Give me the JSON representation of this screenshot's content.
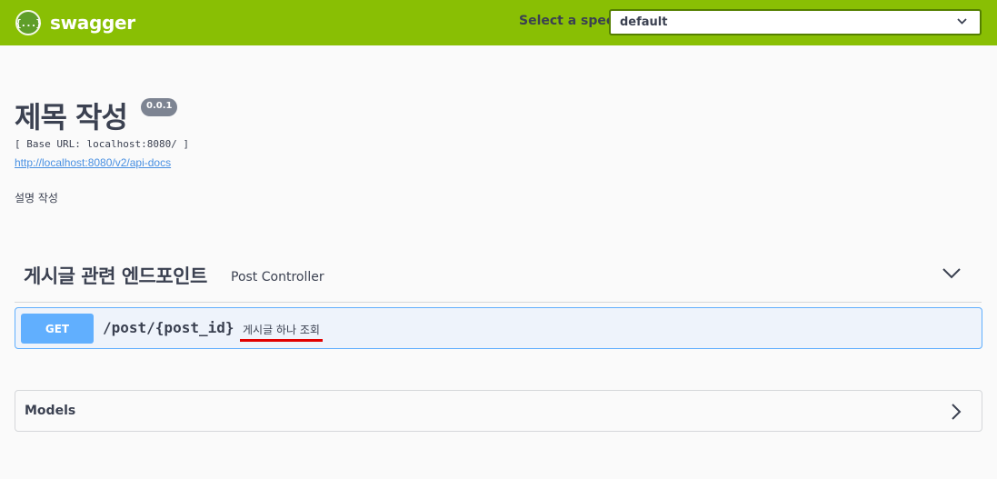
{
  "topbar": {
    "logo_glyph": "{...}",
    "brand": "swagger",
    "select_label": "Select a spec",
    "select_value": "default",
    "color": "#89bf04"
  },
  "info": {
    "title": "제목 작성",
    "version": "0.0.1",
    "base_url": "[ Base URL: localhost:8080/ ]",
    "docs_link": "http://localhost:8080/v2/api-docs",
    "description": "설명 작성"
  },
  "tag": {
    "name": "게시글 관련 엔드포인트",
    "description": "Post Controller",
    "expand_icon": "chevron-down-icon"
  },
  "operations": [
    {
      "method": "GET",
      "path": "/post/{post_id}",
      "summary": "게시글 하나 조회",
      "color": "#61affe"
    }
  ],
  "models": {
    "title": "Models",
    "expand_icon": "chevron-right-icon"
  }
}
